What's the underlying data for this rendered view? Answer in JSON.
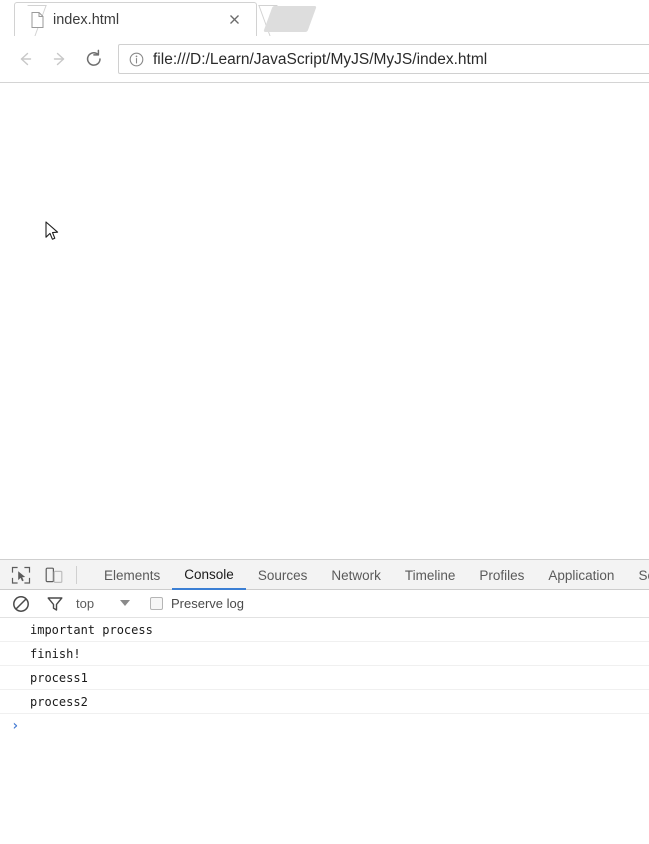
{
  "browser": {
    "tab": {
      "title": "index.html",
      "page_icon": "page-icon",
      "close_icon": "close-icon"
    },
    "new_tab_stub": "",
    "toolbar": {
      "back_icon": "arrow-left-icon",
      "forward_icon": "arrow-right-icon",
      "reload_icon": "reload-icon",
      "omnibox": {
        "info_icon": "info-circle-icon",
        "url": "file:///D:/Learn/JavaScript/MyJS/MyJS/index.html"
      }
    }
  },
  "page": {
    "content": "",
    "cursor_icon": "mouse-pointer-icon"
  },
  "devtools": {
    "toolbar_icons": {
      "inspect": "inspect-element-icon",
      "device": "device-toolbar-icon"
    },
    "tabs": [
      {
        "label": "Elements",
        "active": false
      },
      {
        "label": "Console",
        "active": true
      },
      {
        "label": "Sources",
        "active": false
      },
      {
        "label": "Network",
        "active": false
      },
      {
        "label": "Timeline",
        "active": false
      },
      {
        "label": "Profiles",
        "active": false
      },
      {
        "label": "Application",
        "active": false
      },
      {
        "label": "Se",
        "active": false
      }
    ],
    "filter_bar": {
      "clear_icon": "clear-console-icon",
      "filter_icon": "filter-funnel-icon",
      "context": "top",
      "caret_icon": "chevron-down-icon",
      "preserve_log_checked": false,
      "preserve_log_label": "Preserve log"
    },
    "console": {
      "messages": [
        "important process",
        "finish!",
        "process1",
        "process2"
      ],
      "prompt_caret": "›",
      "prompt_value": ""
    },
    "accent_color": "#3b7fd4"
  }
}
